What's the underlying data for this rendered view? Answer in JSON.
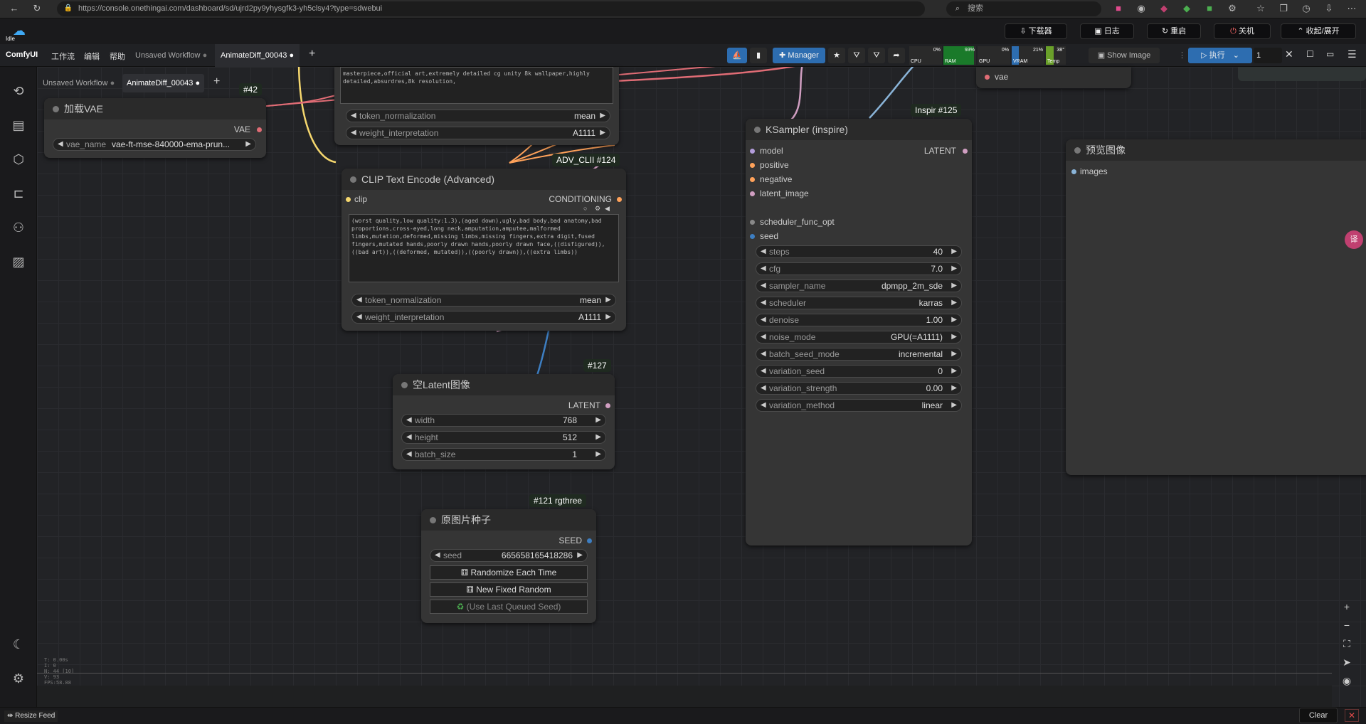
{
  "browser": {
    "url": "https://console.onethingai.com/dashboard/sd/ujrd2py9yhysgfk3-yh5clsy4?type=sdwebui",
    "search_placeholder": "搜索"
  },
  "app_top": {
    "download_label": "下载器",
    "log_label": "日志",
    "restart_label": "重启",
    "shutdown_label": "关机",
    "collapse_label": "收起/展开",
    "status": "Idle"
  },
  "menu": {
    "brand": "ComfyUI",
    "items": [
      "工作流",
      "编辑",
      "帮助"
    ],
    "tabs": [
      "Unsaved Workflow",
      "AnimateDiff_00043"
    ],
    "manager_label": "Manager",
    "show_image_feed": "Show Image Feed",
    "run_label": "执行",
    "queue_count": "1",
    "meters": [
      {
        "label": "CPU",
        "value": "0%"
      },
      {
        "label": "RAM",
        "value": "93%"
      },
      {
        "label": "GPU",
        "value": "0%"
      },
      {
        "label": "VRAM",
        "value": "21%"
      },
      {
        "label": "Temp",
        "value": "38°"
      }
    ]
  },
  "canvas_tabs": [
    "Unsaved Workflow",
    "AnimateDiff_00043"
  ],
  "nodes": {
    "vae_loader": {
      "badge": "#42",
      "title": "加载VAE",
      "output": "VAE",
      "widget_name": "vae_name",
      "widget_value": "vae-ft-mse-840000-ema-prun..."
    },
    "clip_top": {
      "text": "masterpiece,official art,extremely detailed cg unity 8k wallpaper,highly detailed,absurdres,8k resolution,",
      "w1_name": "token_normalization",
      "w1_value": "mean",
      "w2_name": "weight_interpretation",
      "w2_value": "A1111"
    },
    "clip_neg": {
      "badge": "ADV_CLII #124",
      "title": "CLIP Text Encode (Advanced)",
      "input": "clip",
      "output": "CONDITIONING",
      "text": "(worst quality,low quality:1.3),(aged down),ugly,bad body,bad anatomy,bad proportions,cross-eyed,long neck,amputation,amputee,malformed limbs,mutation,deformed,missing limbs,missing fingers,extra digit,fused fingers,mutated hands,poorly drawn hands,poorly drawn face,((disfigured)),((bad art)),((deformed, mutated)),((poorly drawn)),((extra limbs))",
      "w1_name": "token_normalization",
      "w1_value": "mean",
      "w2_name": "weight_interpretation",
      "w2_value": "A1111"
    },
    "empty_latent": {
      "badge": "#127",
      "title": "空Latent图像",
      "output": "LATENT",
      "widgets": [
        {
          "name": "width",
          "value": "768"
        },
        {
          "name": "height",
          "value": "512"
        },
        {
          "name": "batch_size",
          "value": "1"
        }
      ]
    },
    "seed": {
      "badge": "#121 rgthree",
      "title": "原图片种子",
      "output": "SEED",
      "seed_name": "seed",
      "seed_value": "665658165418286",
      "btn_random": "Randomize Each Time",
      "btn_fixed": "New Fixed Random",
      "btn_last": "(Use Last Queued Seed)"
    },
    "ksampler": {
      "badge": "Inspir #125",
      "title": "KSampler (inspire)",
      "inputs": [
        "model",
        "positive",
        "negative",
        "latent_image",
        "scheduler_func_opt",
        "seed"
      ],
      "output": "LATENT",
      "widgets": [
        {
          "name": "steps",
          "value": "40"
        },
        {
          "name": "cfg",
          "value": "7.0"
        },
        {
          "name": "sampler_name",
          "value": "dpmpp_2m_sde"
        },
        {
          "name": "scheduler",
          "value": "karras"
        },
        {
          "name": "denoise",
          "value": "1.00"
        },
        {
          "name": "noise_mode",
          "value": "GPU(=A1111)"
        },
        {
          "name": "batch_seed_mode",
          "value": "incremental"
        },
        {
          "name": "variation_seed",
          "value": "0"
        },
        {
          "name": "variation_strength",
          "value": "0.00"
        },
        {
          "name": "variation_method",
          "value": "linear"
        }
      ]
    },
    "vae_decode_input": "vae",
    "preview": {
      "title": "预览图像",
      "input": "images"
    }
  },
  "stats": [
    "T: 0.00s",
    "I: 0",
    "N: 44 [10]",
    "V: 93",
    "FPS:58.88"
  ],
  "bottom": {
    "resize_feed": "Resize Feed",
    "clear": "Clear"
  },
  "colors": {
    "vae": "#e06c75",
    "clip": "#f5d76e",
    "conditioning": "#ffa25a",
    "latent": "#d09ec1",
    "model": "#b39ddb",
    "int": "#3d7ec2",
    "accent": "#2d6db0"
  }
}
